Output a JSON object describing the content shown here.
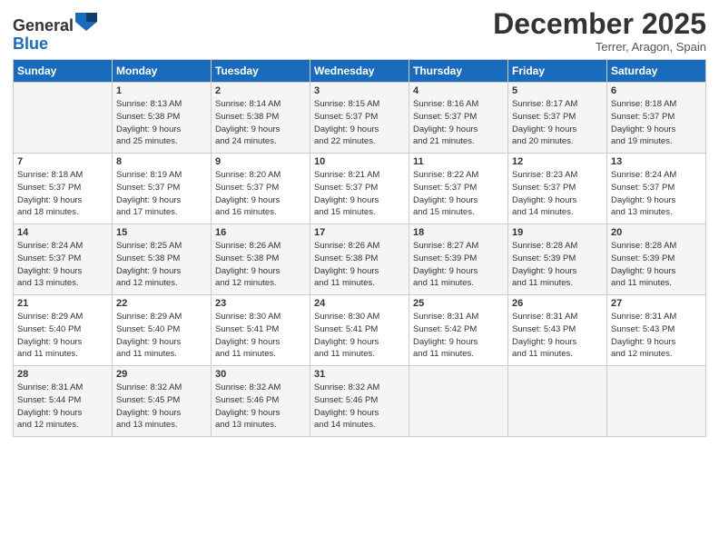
{
  "header": {
    "logo_general": "General",
    "logo_blue": "Blue",
    "month_title": "December 2025",
    "subtitle": "Terrer, Aragon, Spain"
  },
  "weekdays": [
    "Sunday",
    "Monday",
    "Tuesday",
    "Wednesday",
    "Thursday",
    "Friday",
    "Saturday"
  ],
  "weeks": [
    [
      {
        "day": "",
        "text": ""
      },
      {
        "day": "1",
        "text": "Sunrise: 8:13 AM\nSunset: 5:38 PM\nDaylight: 9 hours\nand 25 minutes."
      },
      {
        "day": "2",
        "text": "Sunrise: 8:14 AM\nSunset: 5:38 PM\nDaylight: 9 hours\nand 24 minutes."
      },
      {
        "day": "3",
        "text": "Sunrise: 8:15 AM\nSunset: 5:37 PM\nDaylight: 9 hours\nand 22 minutes."
      },
      {
        "day": "4",
        "text": "Sunrise: 8:16 AM\nSunset: 5:37 PM\nDaylight: 9 hours\nand 21 minutes."
      },
      {
        "day": "5",
        "text": "Sunrise: 8:17 AM\nSunset: 5:37 PM\nDaylight: 9 hours\nand 20 minutes."
      },
      {
        "day": "6",
        "text": "Sunrise: 8:18 AM\nSunset: 5:37 PM\nDaylight: 9 hours\nand 19 minutes."
      }
    ],
    [
      {
        "day": "7",
        "text": "Sunrise: 8:18 AM\nSunset: 5:37 PM\nDaylight: 9 hours\nand 18 minutes."
      },
      {
        "day": "8",
        "text": "Sunrise: 8:19 AM\nSunset: 5:37 PM\nDaylight: 9 hours\nand 17 minutes."
      },
      {
        "day": "9",
        "text": "Sunrise: 8:20 AM\nSunset: 5:37 PM\nDaylight: 9 hours\nand 16 minutes."
      },
      {
        "day": "10",
        "text": "Sunrise: 8:21 AM\nSunset: 5:37 PM\nDaylight: 9 hours\nand 15 minutes."
      },
      {
        "day": "11",
        "text": "Sunrise: 8:22 AM\nSunset: 5:37 PM\nDaylight: 9 hours\nand 15 minutes."
      },
      {
        "day": "12",
        "text": "Sunrise: 8:23 AM\nSunset: 5:37 PM\nDaylight: 9 hours\nand 14 minutes."
      },
      {
        "day": "13",
        "text": "Sunrise: 8:24 AM\nSunset: 5:37 PM\nDaylight: 9 hours\nand 13 minutes."
      }
    ],
    [
      {
        "day": "14",
        "text": "Sunrise: 8:24 AM\nSunset: 5:37 PM\nDaylight: 9 hours\nand 13 minutes."
      },
      {
        "day": "15",
        "text": "Sunrise: 8:25 AM\nSunset: 5:38 PM\nDaylight: 9 hours\nand 12 minutes."
      },
      {
        "day": "16",
        "text": "Sunrise: 8:26 AM\nSunset: 5:38 PM\nDaylight: 9 hours\nand 12 minutes."
      },
      {
        "day": "17",
        "text": "Sunrise: 8:26 AM\nSunset: 5:38 PM\nDaylight: 9 hours\nand 11 minutes."
      },
      {
        "day": "18",
        "text": "Sunrise: 8:27 AM\nSunset: 5:39 PM\nDaylight: 9 hours\nand 11 minutes."
      },
      {
        "day": "19",
        "text": "Sunrise: 8:28 AM\nSunset: 5:39 PM\nDaylight: 9 hours\nand 11 minutes."
      },
      {
        "day": "20",
        "text": "Sunrise: 8:28 AM\nSunset: 5:39 PM\nDaylight: 9 hours\nand 11 minutes."
      }
    ],
    [
      {
        "day": "21",
        "text": "Sunrise: 8:29 AM\nSunset: 5:40 PM\nDaylight: 9 hours\nand 11 minutes."
      },
      {
        "day": "22",
        "text": "Sunrise: 8:29 AM\nSunset: 5:40 PM\nDaylight: 9 hours\nand 11 minutes."
      },
      {
        "day": "23",
        "text": "Sunrise: 8:30 AM\nSunset: 5:41 PM\nDaylight: 9 hours\nand 11 minutes."
      },
      {
        "day": "24",
        "text": "Sunrise: 8:30 AM\nSunset: 5:41 PM\nDaylight: 9 hours\nand 11 minutes."
      },
      {
        "day": "25",
        "text": "Sunrise: 8:31 AM\nSunset: 5:42 PM\nDaylight: 9 hours\nand 11 minutes."
      },
      {
        "day": "26",
        "text": "Sunrise: 8:31 AM\nSunset: 5:43 PM\nDaylight: 9 hours\nand 11 minutes."
      },
      {
        "day": "27",
        "text": "Sunrise: 8:31 AM\nSunset: 5:43 PM\nDaylight: 9 hours\nand 12 minutes."
      }
    ],
    [
      {
        "day": "28",
        "text": "Sunrise: 8:31 AM\nSunset: 5:44 PM\nDaylight: 9 hours\nand 12 minutes."
      },
      {
        "day": "29",
        "text": "Sunrise: 8:32 AM\nSunset: 5:45 PM\nDaylight: 9 hours\nand 13 minutes."
      },
      {
        "day": "30",
        "text": "Sunrise: 8:32 AM\nSunset: 5:46 PM\nDaylight: 9 hours\nand 13 minutes."
      },
      {
        "day": "31",
        "text": "Sunrise: 8:32 AM\nSunset: 5:46 PM\nDaylight: 9 hours\nand 14 minutes."
      },
      {
        "day": "",
        "text": ""
      },
      {
        "day": "",
        "text": ""
      },
      {
        "day": "",
        "text": ""
      }
    ]
  ]
}
